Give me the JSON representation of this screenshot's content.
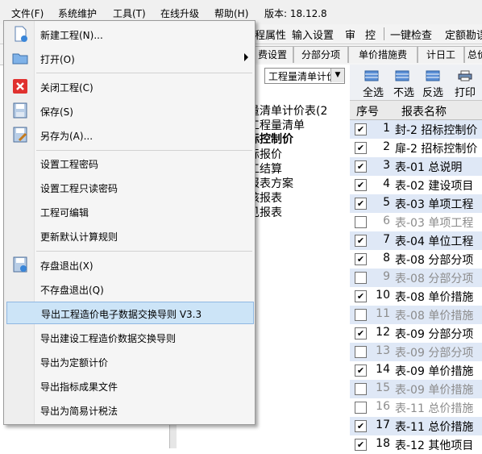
{
  "menubar": {
    "items": [
      "文件(F)",
      "系统维护",
      "工具(T)",
      "在线升级",
      "帮助(H)",
      "版本: 18.12.8"
    ]
  },
  "toolbar": {
    "items": [
      "程属性",
      "输入设置",
      "审",
      "控",
      "一键检查",
      "定额勘误"
    ]
  },
  "tabs": [
    "费设置",
    "分部分项",
    "单价措施费",
    "计日工",
    "总价"
  ],
  "left_panel": {
    "combo_value": "工程量清单计价",
    "tree": [
      "量清单计价表(2",
      "工程量清单",
      "标控制价",
      "标报价",
      "工结算",
      "报表方案",
      "核报表",
      "见报表"
    ]
  },
  "right_toolbar": {
    "buttons": [
      "全选",
      "不选",
      "反选",
      "打印"
    ]
  },
  "grid": {
    "columns": [
      "序号",
      "报表名称"
    ],
    "rows": [
      {
        "checked": true,
        "num": "1",
        "name": "封-2 招标控制价"
      },
      {
        "checked": true,
        "num": "2",
        "name": "扉-2 招标控制价"
      },
      {
        "checked": true,
        "num": "3",
        "name": "表-01 总说明"
      },
      {
        "checked": true,
        "num": "4",
        "name": "表-02 建设项目"
      },
      {
        "checked": true,
        "num": "5",
        "name": "表-03 单项工程"
      },
      {
        "checked": false,
        "num": "6",
        "name": "表-03 单项工程"
      },
      {
        "checked": true,
        "num": "7",
        "name": "表-04 单位工程"
      },
      {
        "checked": true,
        "num": "8",
        "name": "表-08 分部分项"
      },
      {
        "checked": false,
        "num": "9",
        "name": "表-08 分部分项"
      },
      {
        "checked": true,
        "num": "10",
        "name": "表-08 单价措施"
      },
      {
        "checked": false,
        "num": "11",
        "name": "表-08 单价措施"
      },
      {
        "checked": true,
        "num": "12",
        "name": "表-09 分部分项"
      },
      {
        "checked": false,
        "num": "13",
        "name": "表-09 分部分项"
      },
      {
        "checked": true,
        "num": "14",
        "name": "表-09 单价措施"
      },
      {
        "checked": false,
        "num": "15",
        "name": "表-09 单价措施"
      },
      {
        "checked": false,
        "num": "16",
        "name": "表-11 总价措施"
      },
      {
        "checked": true,
        "num": "17",
        "name": "表-11 总价措施"
      },
      {
        "checked": true,
        "num": "18",
        "name": "表-12 其他项目"
      }
    ]
  },
  "file_menu": {
    "items": [
      {
        "label": "新建工程(N)...",
        "icon": "new-document-icon"
      },
      {
        "label": "打开(O)",
        "icon": "folder-icon",
        "submenu": true
      },
      {
        "label": "关闭工程(C)",
        "icon": "close-red-icon"
      },
      {
        "label": "保存(S)",
        "icon": "save-icon"
      },
      {
        "label": "另存为(A)...",
        "icon": "save-as-icon"
      },
      {
        "label": "设置工程密码"
      },
      {
        "label": "设置工程只读密码"
      },
      {
        "label": "工程可编辑"
      },
      {
        "label": "更新默认计算规则"
      },
      {
        "label": "存盘退出(X)",
        "icon": "save-exit-icon"
      },
      {
        "label": "不存盘退出(Q)"
      },
      {
        "label": "导出工程造价电子数据交换导则 V3.3",
        "highlighted": true
      },
      {
        "label": "导出建设工程造价数据交换导则"
      },
      {
        "label": "导出为定额计价"
      },
      {
        "label": "导出指标成果文件"
      },
      {
        "label": "导出为简易计税法"
      }
    ]
  },
  "colors": {
    "menu_highlight": "#cce4f7",
    "row_alt": "#dfe8f6",
    "close_red": "#e0312f"
  }
}
